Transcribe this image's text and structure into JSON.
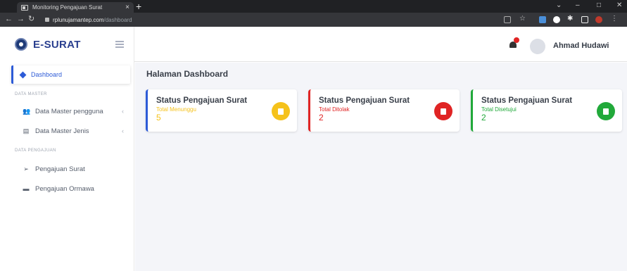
{
  "browser": {
    "tab_title": "Monitoring Pengajuan Surat",
    "tab_close": "×",
    "new_tab": "+",
    "url_host": "rplunujamantep.com",
    "url_path": "/dashboard",
    "controls": {
      "minimize": "–",
      "maximize": "□",
      "close": "✕"
    }
  },
  "sidebar": {
    "brand": "E-SURAT",
    "active_item": "Dashboard",
    "sections": [
      {
        "heading": "DATA MASTER",
        "items": [
          {
            "label": "Data Master pengguna",
            "chevron": "‹"
          },
          {
            "label": "Data Master Jenis",
            "chevron": "‹"
          }
        ]
      },
      {
        "heading": "DATA PENGAJUAN",
        "items": [
          {
            "label": "Pengajuan Surat"
          },
          {
            "label": "Pengajuan Ormawa"
          }
        ]
      }
    ]
  },
  "topbar": {
    "username": "Ahmad Hudawi"
  },
  "main": {
    "title": "Halaman Dashboard",
    "cards": [
      {
        "title": "Status Pengajuan Surat",
        "subtitle": "Total Menunggu",
        "value": "5",
        "color": "#f5c21b",
        "icon": "file-icon"
      },
      {
        "title": "Status Pengajuan Surat",
        "subtitle": "Total Ditolak",
        "value": "2",
        "color": "#e02424",
        "icon": "thumbs-down-icon"
      },
      {
        "title": "Status Pengajuan Surat",
        "subtitle": "Total Disetujui",
        "value": "2",
        "color": "#21a93a",
        "icon": "thumbs-up-icon"
      }
    ]
  },
  "colors": {
    "accent": "#2d5bd7",
    "brand": "#2a3f8f"
  }
}
